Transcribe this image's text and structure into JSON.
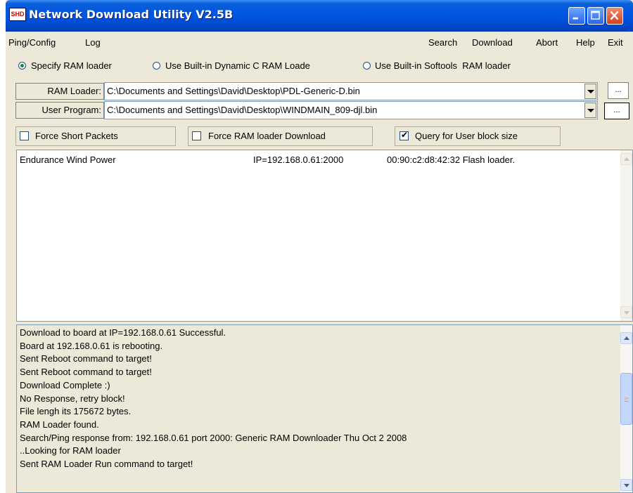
{
  "window": {
    "title": "Network Download Utility V2.5B",
    "icon_text": "SHD",
    "controls": [
      "minimize-icon",
      "maximize-icon",
      "close-icon"
    ]
  },
  "menu": {
    "left": [
      "Ping/Config",
      "Log"
    ],
    "right": [
      "Search",
      "Download",
      "Abort",
      "Help",
      "Exit"
    ]
  },
  "loader_options": {
    "selected": 0,
    "items": [
      "Specify RAM loader",
      "Use Built-in Dynamic C RAM Loade",
      "Use Built-in Softools  RAM loader"
    ]
  },
  "files": {
    "ram_loader_label": "RAM Loader:",
    "ram_loader_value": "C:\\Documents and Settings\\David\\Desktop\\PDL-Generic-D.bin",
    "user_program_label": "User Program:",
    "user_program_value": "C:\\Documents and Settings\\David\\Desktop\\WINDMAIN_809-djl.bin",
    "browse_label": "..."
  },
  "checkboxes": [
    {
      "label": "Force Short Packets",
      "checked": false
    },
    {
      "label": "Force RAM loader Download",
      "checked": false
    },
    {
      "label": "Query for User block size",
      "checked": true
    }
  ],
  "devices": [
    {
      "name": "Endurance Wind Power",
      "ip": "IP=192.168.0.61:2000",
      "mac": "00:90:c2:d8:42:32 Flash loader."
    }
  ],
  "log": [
    "Download to board at IP=192.168.0.61 Successful.",
    "Board at 192.168.0.61 is rebooting.",
    "Sent Reboot command to target!",
    "Sent Reboot command to target!",
    "Download Complete :)",
    "No Response, retry block!",
    "File lengh its 175672 bytes.",
    "RAM Loader found.",
    "Search/Ping response from: 192.168.0.61 port 2000: Generic RAM Downloader Thu Oct  2 2008",
    "..Looking for RAM loader",
    "Sent RAM Loader Run command to target!"
  ],
  "colors": {
    "titlebar": "#0054e3",
    "face": "#ece9d8",
    "radio_dot": "#1a8a1a"
  }
}
